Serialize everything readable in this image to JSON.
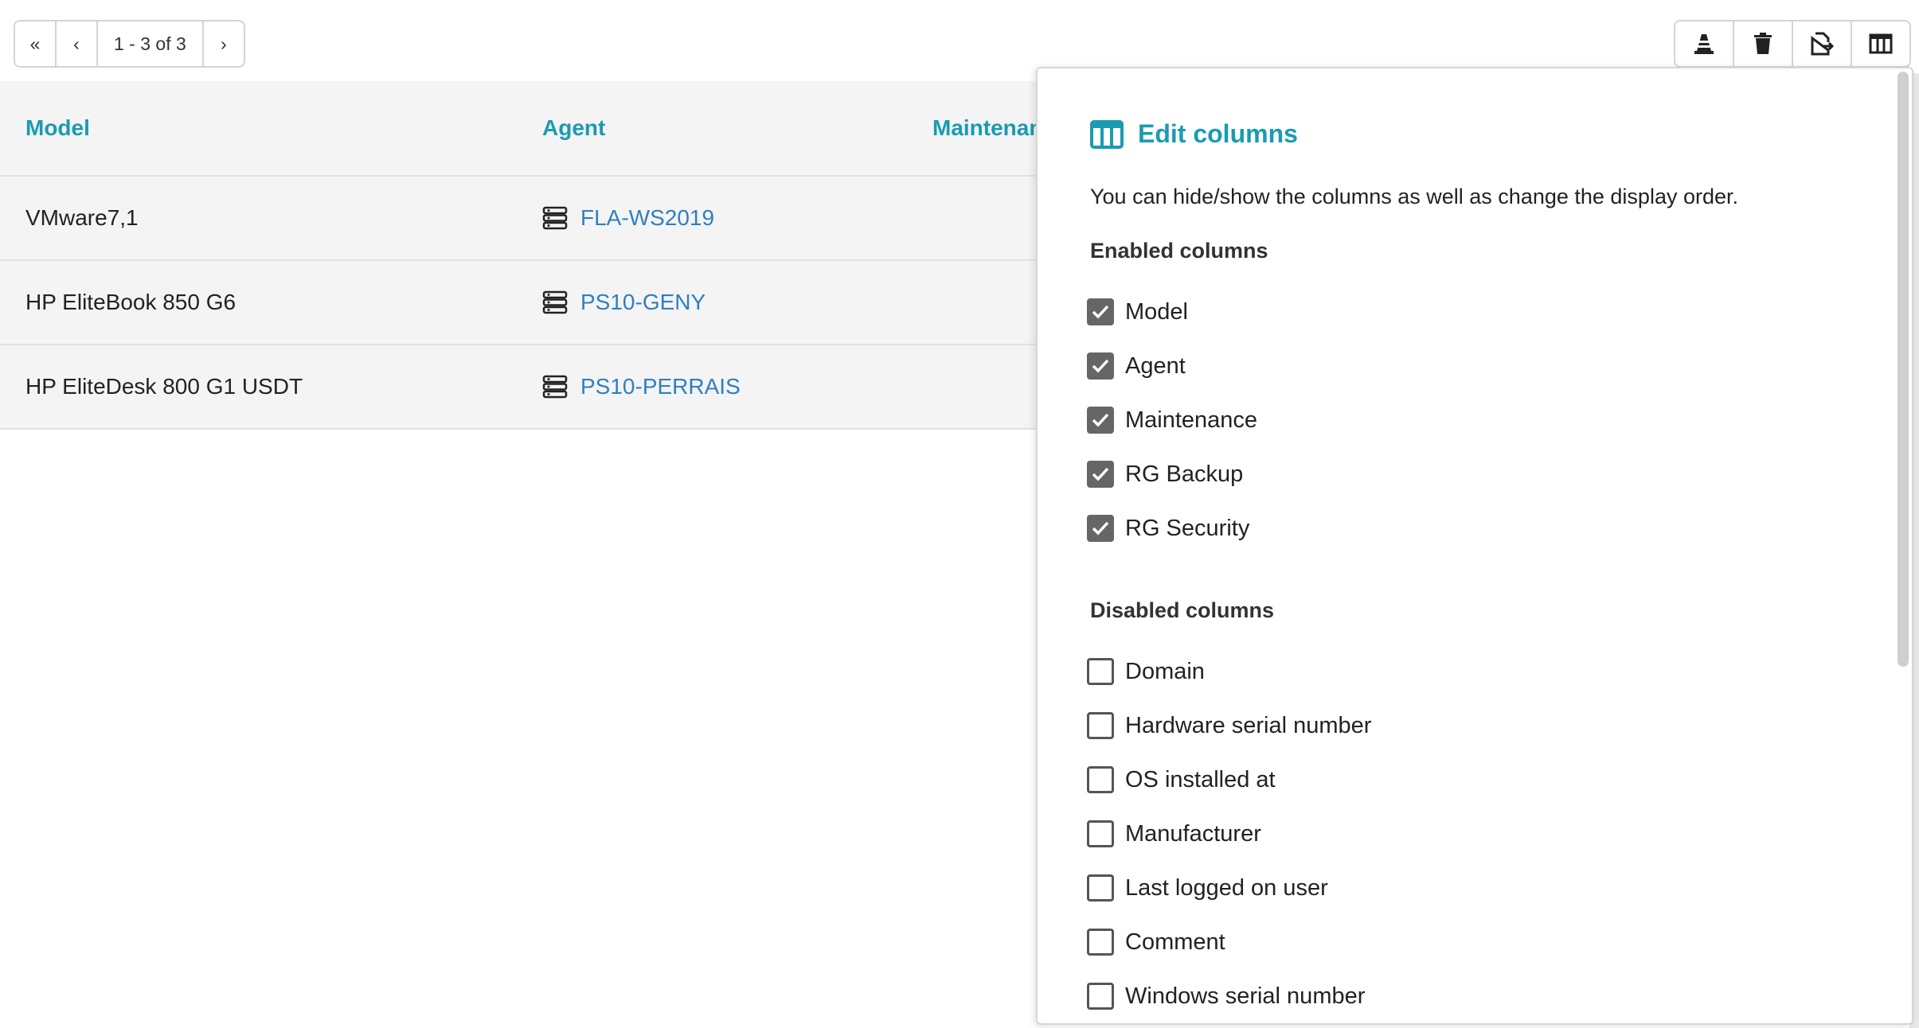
{
  "pagination": {
    "first": "«",
    "prev": "‹",
    "range": "1 - 3 of 3",
    "next": "›"
  },
  "toolbar": {
    "icons": [
      "cone-icon",
      "trash-icon",
      "export-icon",
      "columns-icon"
    ]
  },
  "table": {
    "headers": [
      "Model",
      "Agent",
      "Maintenan"
    ],
    "rows": [
      {
        "model": "VMware7,1",
        "agent": "FLA-WS2019"
      },
      {
        "model": "HP EliteBook 850 G6",
        "agent": "PS10-GENY"
      },
      {
        "model": "HP EliteDesk 800 G1 USDT",
        "agent": "PS10-PERRAIS"
      }
    ]
  },
  "panel": {
    "title": "Edit columns",
    "description": "You can hide/show the columns as well as change the display order.",
    "enabled_heading": "Enabled columns",
    "enabled": [
      "Model",
      "Agent",
      "Maintenance",
      "RG Backup",
      "RG Security"
    ],
    "disabled_heading": "Disabled columns",
    "disabled": [
      "Domain",
      "Hardware serial number",
      "OS installed at",
      "Manufacturer",
      "Last logged on user",
      "Comment",
      "Windows serial number"
    ]
  },
  "colors": {
    "accent": "#1a9bb0",
    "link": "#2f7fc0",
    "row_bg": "#f4f4f4"
  }
}
